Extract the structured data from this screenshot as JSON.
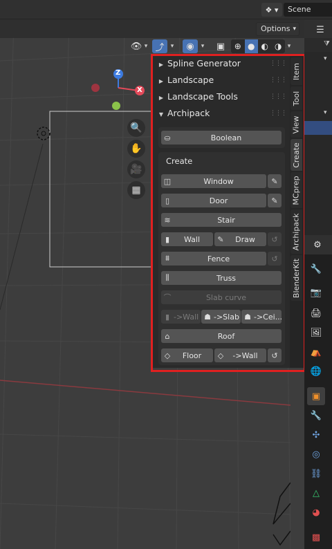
{
  "scene": {
    "name": "Scene",
    "icon": "scene-icon"
  },
  "viewport": {
    "options_label": "Options"
  },
  "sidebar": {
    "panels": [
      {
        "label": "Spline Generator",
        "expanded": false
      },
      {
        "label": "Landscape",
        "expanded": false
      },
      {
        "label": "Landscape Tools",
        "expanded": false
      },
      {
        "label": "Archipack",
        "expanded": true
      }
    ],
    "boolean_label": "Boolean",
    "create_title": "Create",
    "buttons": {
      "window": "Window",
      "door": "Door",
      "stair": "Stair",
      "wall": "Wall",
      "draw": "Draw",
      "fence": "Fence",
      "truss": "Truss",
      "slab_curve": "Slab curve",
      "to_wall": "->Wall",
      "to_slab": "->Slab",
      "to_ceiling": "->Cei...",
      "roof": "Roof",
      "floor": "Floor",
      "floor_to_wall": "->Wall"
    },
    "tabs": [
      "Item",
      "Tool",
      "View",
      "Create",
      "MCprep",
      "Archipack",
      "BlenderKit"
    ],
    "active_tab": "Create"
  },
  "gizmo": {
    "z_label": "Z",
    "x_label": "X"
  },
  "colors": {
    "accent": "#4772b3",
    "highlight_frame": "#e02020",
    "axis_x": "#e34a5a",
    "axis_z": "#3d7be0",
    "axis_y": "#8bc34a"
  }
}
